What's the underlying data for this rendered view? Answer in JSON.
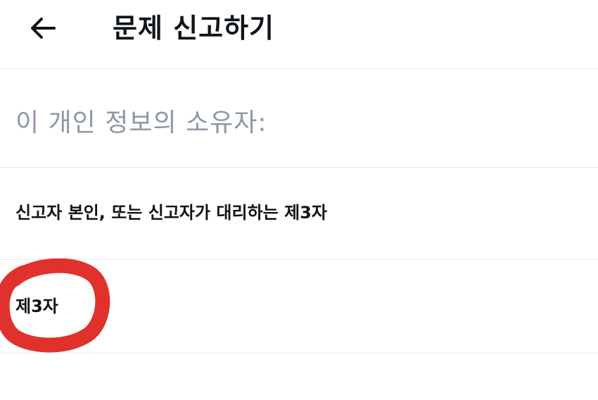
{
  "header": {
    "back_icon": "arrow-left-icon",
    "title": "문제 신고하기"
  },
  "question": {
    "text": "이 개인 정보의 소유자:"
  },
  "options": [
    {
      "label": "신고자 본인, 또는 신고자가 대리하는 제3자"
    },
    {
      "label": "제3자"
    }
  ],
  "annotation": {
    "marker": "red-hand-drawn-circle",
    "color": "#e0312c"
  }
}
